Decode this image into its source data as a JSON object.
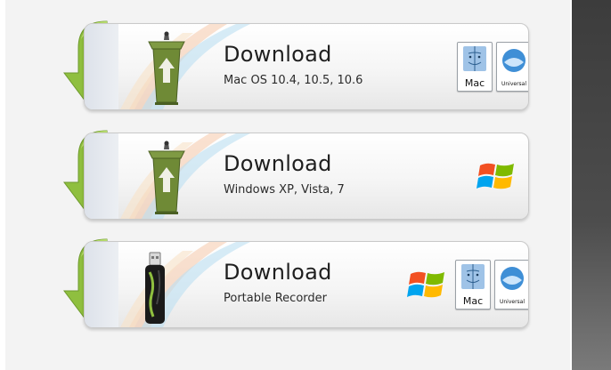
{
  "downloads": [
    {
      "id": "mac",
      "title": "Download",
      "subtitle": "Mac OS 10.4, 10.5, 10.6",
      "icon": "podium-icon",
      "badges": [
        "mac-icon",
        "universal-icon"
      ]
    },
    {
      "id": "windows",
      "title": "Download",
      "subtitle": "Windows XP, Vista, 7",
      "icon": "podium-icon",
      "badges": [
        "windows-logo-icon"
      ]
    },
    {
      "id": "portable",
      "title": "Download",
      "subtitle": "Portable Recorder",
      "icon": "usb-drive-icon",
      "badges": [
        "windows-logo-icon",
        "mac-icon",
        "universal-icon"
      ]
    }
  ],
  "badge_labels": {
    "mac": "Mac",
    "universal": "Universal"
  },
  "colors": {
    "arrow_green": "#8fbf3f",
    "arrow_green_dark": "#6e9a2c",
    "card_border": "#c9c9c9",
    "text": "#1f1f1f",
    "side_strip": "#4a4a4a"
  }
}
